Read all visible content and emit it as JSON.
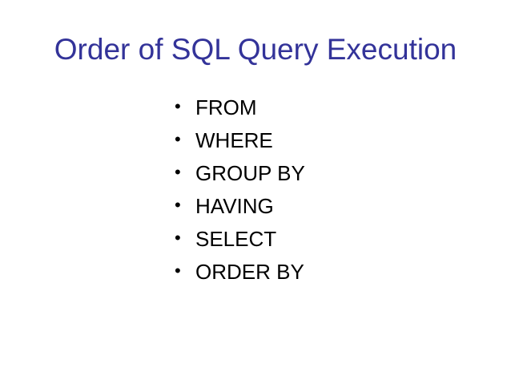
{
  "slide": {
    "title": "Order of SQL Query Execution",
    "bullet_glyph": "•",
    "items": [
      {
        "label": "FROM"
      },
      {
        "label": "WHERE"
      },
      {
        "label": "GROUP BY"
      },
      {
        "label": "HAVING"
      },
      {
        "label": "SELECT"
      },
      {
        "label": "ORDER BY"
      }
    ]
  },
  "colors": {
    "title": "#333399",
    "body_text": "#000000",
    "background": "#ffffff"
  }
}
